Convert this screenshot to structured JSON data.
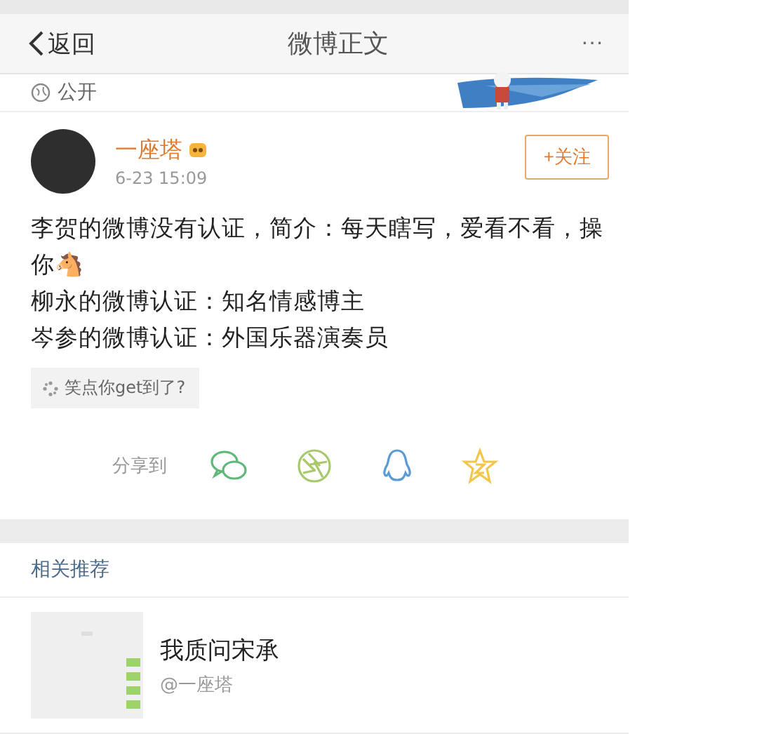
{
  "nav": {
    "back": "返回",
    "title": "微博正文",
    "more": "···"
  },
  "visibility": "公开",
  "post": {
    "author": "一座塔",
    "time": "6-23 15:09",
    "follow": "+关注",
    "lines": [
      "李贺的微博没有认证，简介：每天瞎写，爱看不看，操你🐴",
      "柳永的微博认证：知名情感博主",
      "岑参的微博认证：外国乐器演奏员"
    ],
    "tag": "笑点你get到了?"
  },
  "share": {
    "label": "分享到",
    "targets": [
      {
        "kind": "wechat",
        "color": "#5fb878"
      },
      {
        "kind": "moments",
        "color": "#a8c86a"
      },
      {
        "kind": "qq",
        "color": "#5b9bd5"
      },
      {
        "kind": "qzone",
        "color": "#f2c54b"
      }
    ]
  },
  "related": {
    "heading": "相关推荐",
    "items": [
      {
        "title": "我质问宋承",
        "author": "@一座塔"
      }
    ]
  }
}
